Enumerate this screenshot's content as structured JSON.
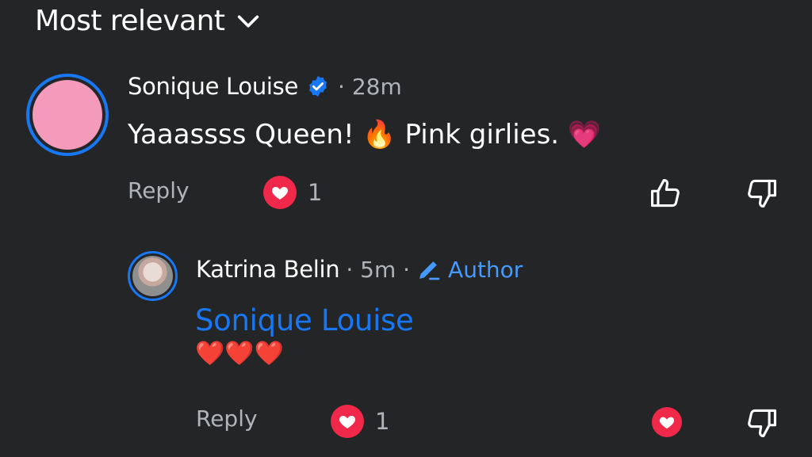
{
  "sort": {
    "label": "Most relevant"
  },
  "comment": {
    "author": "Sonique Louise",
    "time": "· 28m",
    "text": "Yaaassss Queen! 🔥 Pink girlies. 💗",
    "reply_label": "Reply",
    "reaction_count": "1"
  },
  "reply": {
    "author": "Katrina Belin",
    "time": "· 5m ·",
    "badge": "Author",
    "mention": "Sonique Louise",
    "hearts": "❤️❤️❤️",
    "reply_label": "Reply",
    "reaction_count": "1"
  },
  "colors": {
    "background": "#242526",
    "accent": "#1877f2",
    "reaction": "#f0284a",
    "avatar_pink": "#f49aba"
  }
}
